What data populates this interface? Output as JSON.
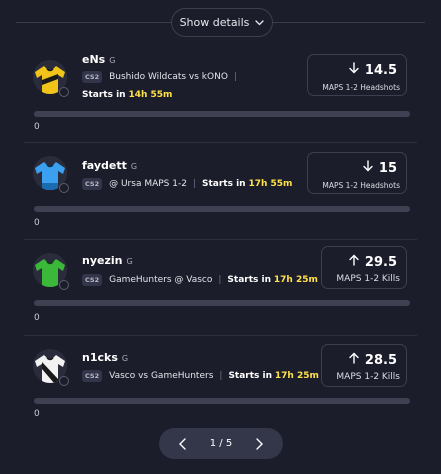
{
  "header": {
    "show_details_label": "Show details"
  },
  "cards": [
    {
      "player": "eNs",
      "position": "G",
      "game": "CS2",
      "matchup": "Bushido Wildcats vs kONO",
      "starts_label": "Starts in",
      "starts_time": "14h 55m",
      "direction": "down",
      "line": "14.5",
      "stat": "MAPS 1-2 Headshots",
      "progress_value": "0",
      "progress_fraction": 0,
      "jersey_color": "#f0c419"
    },
    {
      "player": "faydett",
      "position": "G",
      "game": "CS2",
      "matchup": "@ Ursa MAPS 1-2",
      "starts_label": "Starts in",
      "starts_time": "17h 55m",
      "direction": "down",
      "line": "15",
      "stat": "MAPS 1-2 Headshots",
      "progress_value": "0",
      "progress_fraction": 0,
      "jersey_color": "#3aa0ef"
    },
    {
      "player": "nyezin",
      "position": "G",
      "game": "CS2",
      "matchup": "GameHunters @ Vasco",
      "starts_label": "Starts in",
      "starts_time": "17h 25m",
      "direction": "up",
      "line": "29.5",
      "stat": "MAPS 1-2 Kills",
      "progress_value": "0",
      "progress_fraction": 0,
      "jersey_color": "#3bb83a"
    },
    {
      "player": "n1cks",
      "position": "G",
      "game": "CS2",
      "matchup": "Vasco vs GameHunters",
      "starts_label": "Starts in",
      "starts_time": "17h 25m",
      "direction": "up",
      "line": "28.5",
      "stat": "MAPS 1-2 Kills",
      "progress_value": "0",
      "progress_fraction": 0,
      "jersey_color": "#f2f2f2"
    }
  ],
  "pagination": {
    "label": "1 / 5"
  },
  "colors": {
    "background": "#1c1d2b",
    "highlight": "#ffe14a",
    "bar_track": "#3f4152"
  },
  "icons": {
    "chevron": "chevron-down-icon",
    "prev": "chevron-left-icon",
    "next": "chevron-right-icon",
    "arrow_down": "arrow-down-icon",
    "arrow_up": "arrow-up-icon"
  }
}
